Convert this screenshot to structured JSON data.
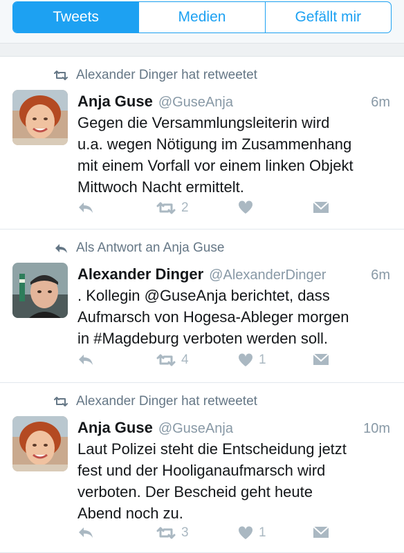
{
  "tabs": [
    {
      "label": "Tweets",
      "active": true
    },
    {
      "label": "Medien",
      "active": false
    },
    {
      "label": "Gefällt mir",
      "active": false
    }
  ],
  "tweets": [
    {
      "context": "Alexander Dinger hat retweetet",
      "context_icon": "retweet-icon",
      "name": "Anja Guse",
      "handle": "@GuseAnja",
      "time": "6m",
      "text": "Gegen die Versammlungsleiterin wird\nu.a. wegen Nötigung im Zusammenhang\nmit einem Vorfall vor einem linken Objekt\nMittwoch Nacht ermittelt.",
      "retweets": "2",
      "likes": ""
    },
    {
      "context": "Als Antwort an Anja Guse",
      "context_icon": "reply-icon",
      "name": "Alexander Dinger",
      "handle": "@AlexanderDinger",
      "time": "6m",
      "text": ". Kollegin @GuseAnja berichtet, dass\nAufmarsch von Hogesa-Ableger morgen\nin #Magdeburg verboten werden soll.",
      "retweets": "4",
      "likes": "1"
    },
    {
      "context": "Alexander Dinger hat retweetet",
      "context_icon": "retweet-icon",
      "name": "Anja Guse",
      "handle": "@GuseAnja",
      "time": "10m",
      "text": "Laut Polizei steht die Entscheidung jetzt\nfest und der Hooliganaufmarsch wird\nverboten. Der Bescheid geht heute\nAbend noch zu.",
      "retweets": "3",
      "likes": "1"
    }
  ],
  "colors": {
    "accent": "#1da1f2",
    "muted": "#657786",
    "icon": "#aab8c2"
  }
}
